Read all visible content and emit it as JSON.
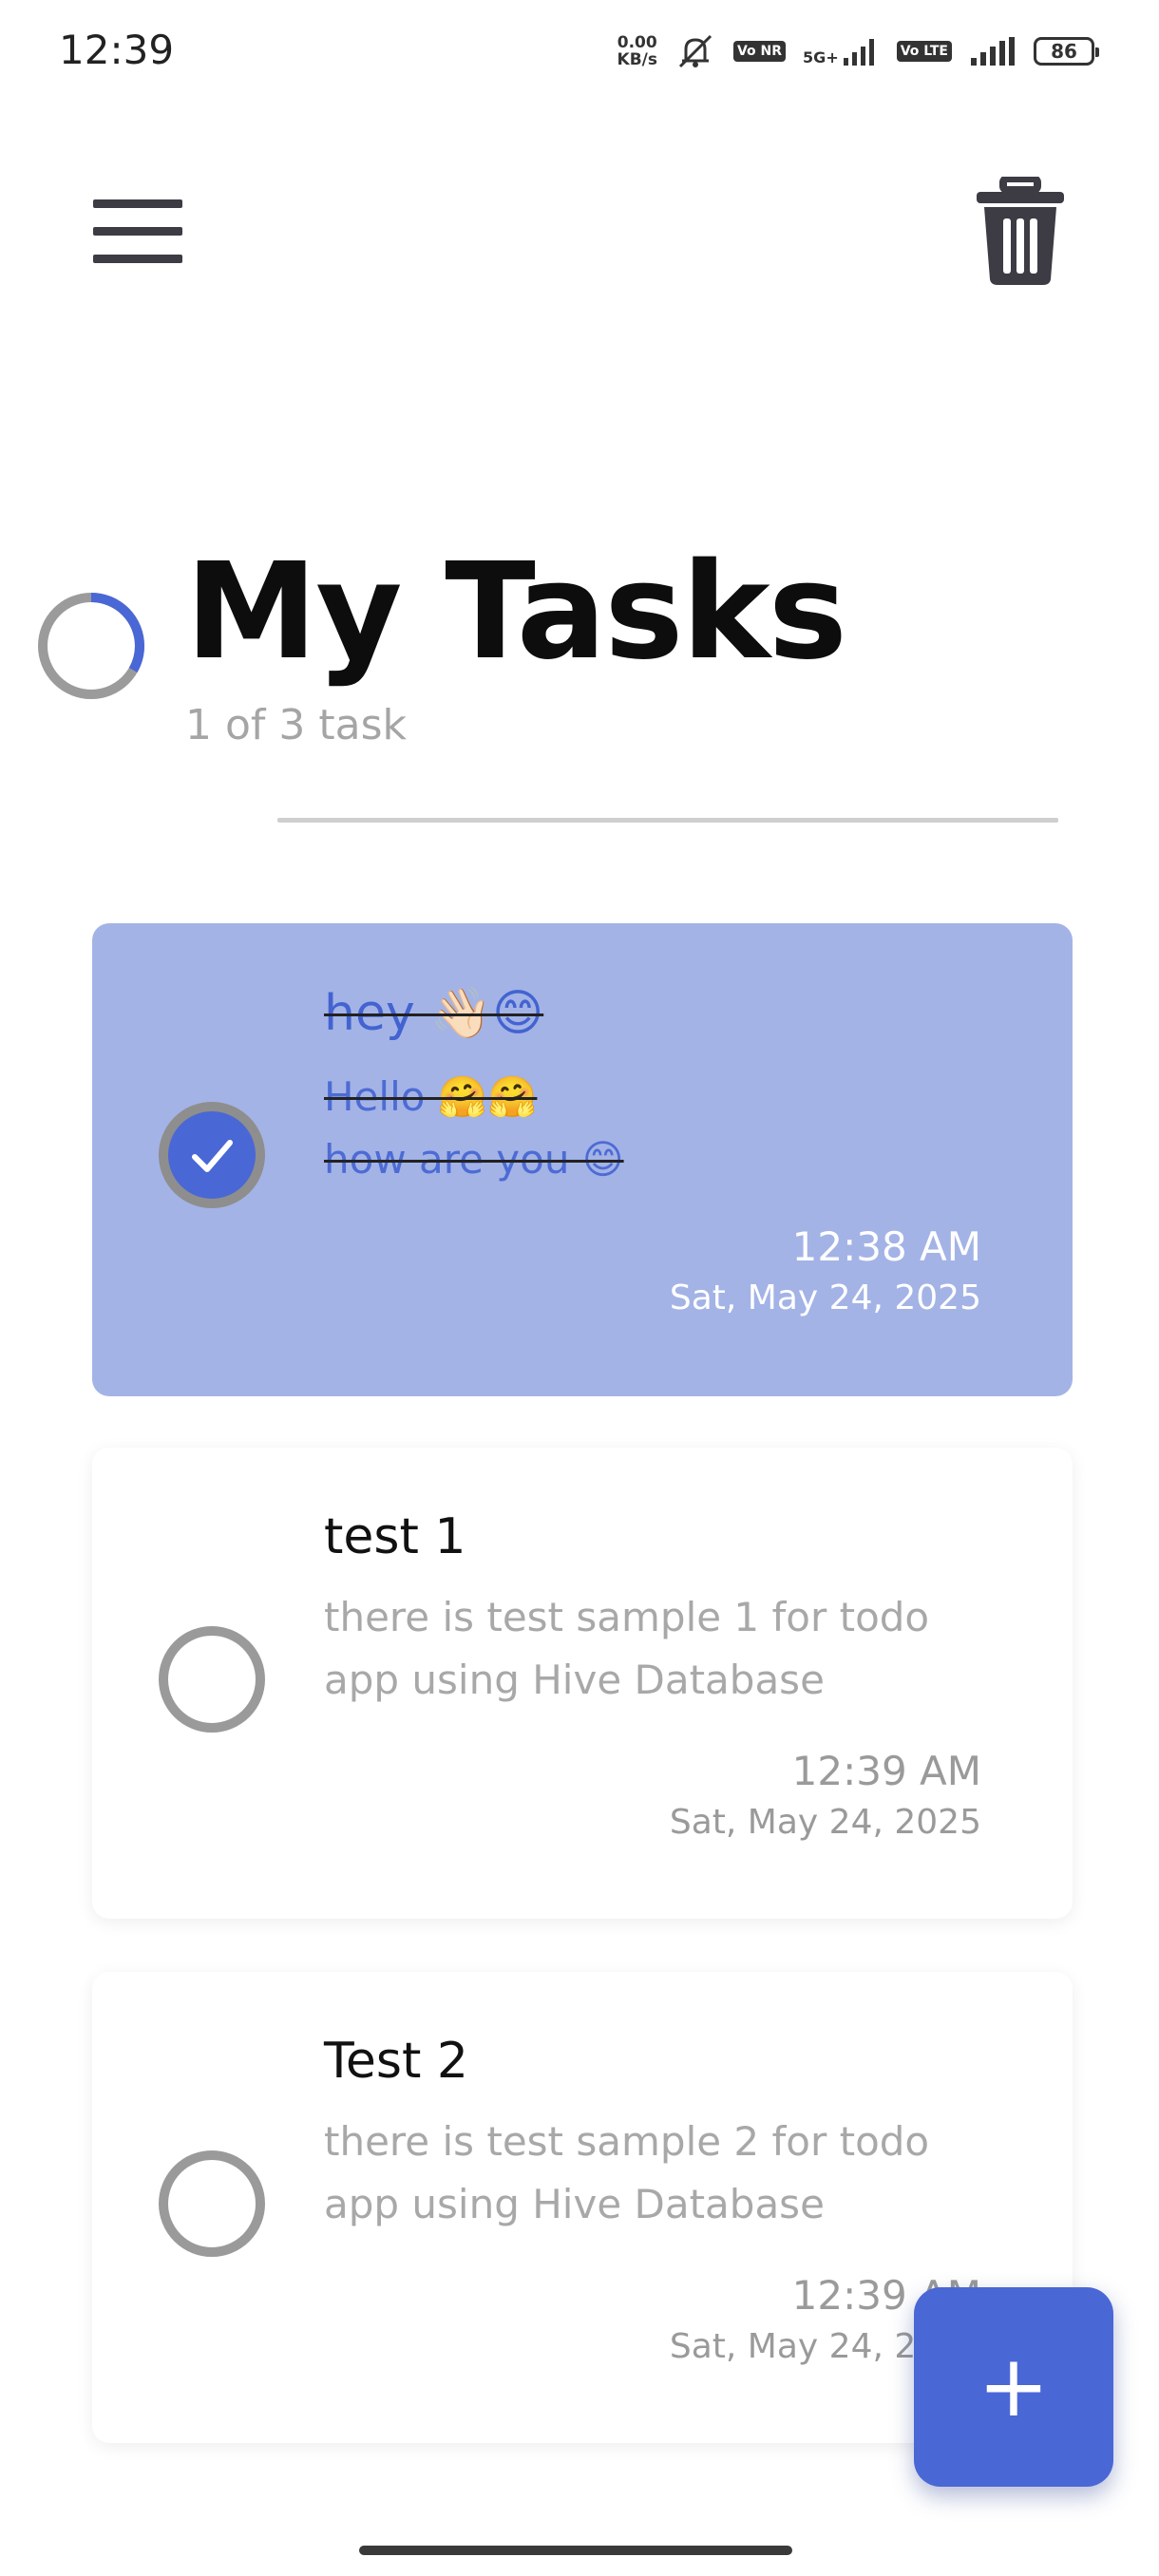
{
  "status_bar": {
    "time": "12:39",
    "net_speed_value": "0.00",
    "net_speed_unit": "KB/s",
    "badge_vonr": "Vo NR",
    "badge_volte": "Vo LTE",
    "signal_label": "5G+",
    "battery": "86"
  },
  "header": {
    "menu_icon": "hamburger-menu-icon",
    "delete_icon": "trash-icon"
  },
  "title": {
    "heading": "My Tasks",
    "count_text": "1 of 3 task",
    "progress_fraction": 0.333
  },
  "tasks": [
    {
      "title": "hey 👋🏻😊",
      "description": "Hello 🤗🤗\nhow are you 😊",
      "time": "12:38 AM",
      "date": "Sat, May 24, 2025",
      "completed": true
    },
    {
      "title": "test 1",
      "description": "there is test sample 1 for  todo app using Hive Database",
      "time": "12:39 AM",
      "date": "Sat, May 24, 2025",
      "completed": false
    },
    {
      "title": "Test 2",
      "description": "there is test sample 2 for  todo app using Hive Database",
      "time": "12:39 AM",
      "date": "Sat, May 24, 2025",
      "completed": false
    }
  ],
  "fab": {
    "label": "+",
    "icon": "plus-icon"
  },
  "colors": {
    "accent": "#4a67d6",
    "done_card": "#a3b3e6",
    "muted_text": "#a8a8a8"
  }
}
